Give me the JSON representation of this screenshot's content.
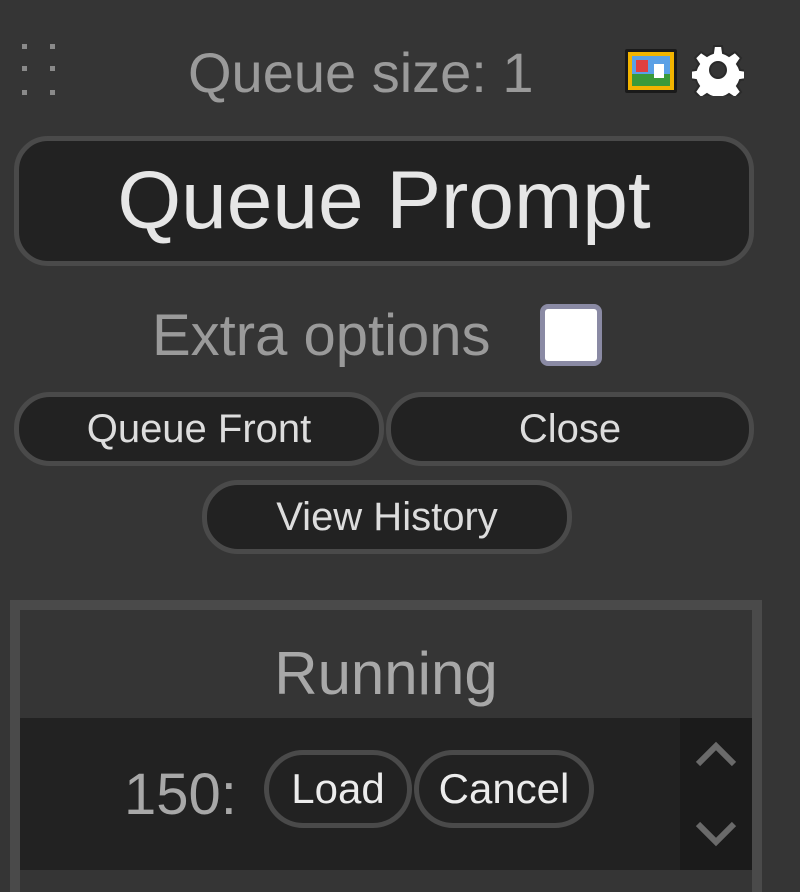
{
  "header": {
    "queue_size_text": "Queue size: 1",
    "icons": [
      "image-icon",
      "gear-icon"
    ]
  },
  "actions": {
    "queue_prompt_label": "Queue Prompt",
    "extra_options_label": "Extra options",
    "extra_options_checked": false,
    "queue_front_label": "Queue Front",
    "close_label": "Close",
    "view_history_label": "View History"
  },
  "running_panel": {
    "title": "Running",
    "items": [
      {
        "id_label": "150:",
        "load_label": "Load",
        "cancel_label": "Cancel"
      }
    ]
  },
  "colors": {
    "background": "#353535",
    "button_bg": "#222222",
    "button_border": "#4a4a4a",
    "text_muted": "#9a9a9a",
    "text_bright": "#e6e6e6"
  }
}
